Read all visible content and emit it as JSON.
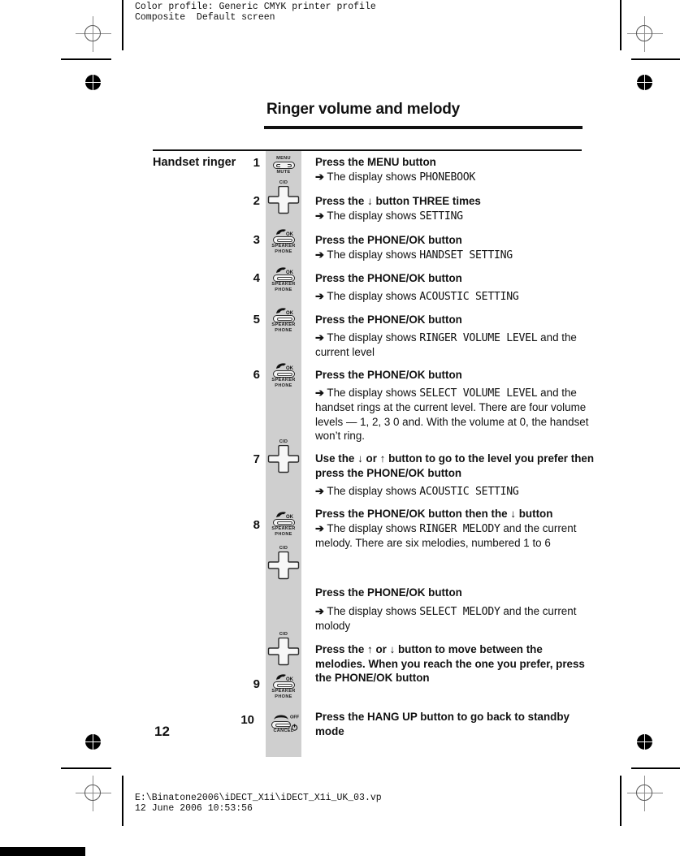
{
  "prepress": {
    "profile_line": "Color profile: Generic CMYK printer profile\nComposite  Default screen",
    "footer_path": "E:\\Binatone2006\\iDECT_X1i\\iDECT_X1i_UK_03.vp\n12 June 2006 10:53:56"
  },
  "page": {
    "title": "Ringer volume and melody",
    "number": "12",
    "section_label": "Handset ringer"
  },
  "steps": [
    {
      "num": "1",
      "icon": "menu-mute-key",
      "lines": [
        {
          "type": "header",
          "parts": [
            {
              "t": "Press the ",
              "style": "bold"
            },
            {
              "t": "MENU",
              "style": "bold"
            },
            {
              "t": " button",
              "style": "bold"
            }
          ]
        },
        {
          "type": "result",
          "arrow": "➔",
          "label": "The display shows",
          "lcd": "PHONEBOOK"
        }
      ]
    },
    {
      "num": "2",
      "icon": "dpad-cid-key",
      "lines": [
        {
          "type": "header",
          "parts": [
            {
              "t": "Press the ",
              "style": "bold"
            },
            {
              "t": "↓",
              "style": "bold"
            },
            {
              "t": " button THREE times",
              "style": "bold"
            }
          ]
        },
        {
          "type": "result",
          "arrow": "➔",
          "label": "The display shows",
          "lcd": "SETTING"
        }
      ]
    },
    {
      "num": "3",
      "icon": "phone-ok-key",
      "lines": [
        {
          "type": "header",
          "parts": [
            {
              "t": "Press the ",
              "style": "bold"
            },
            {
              "t": "PHONE/OK",
              "style": "bold"
            },
            {
              "t": " button",
              "style": "bold"
            }
          ]
        },
        {
          "type": "result",
          "arrow": "➔",
          "label": "The display shows",
          "lcd": "HANDSET SETTING"
        }
      ]
    },
    {
      "num": "4",
      "icon": "phone-ok-key",
      "lines": [
        {
          "type": "header",
          "parts": [
            {
              "t": "Press the ",
              "style": "bold"
            },
            {
              "t": "PHONE/OK",
              "style": "bold"
            },
            {
              "t": " button",
              "style": "bold"
            }
          ]
        },
        {
          "type": "result",
          "arrow": "➔",
          "label": "The display shows",
          "lcd": "ACOUSTIC SETTING"
        }
      ]
    },
    {
      "num": "5",
      "icon": "phone-ok-key",
      "lines": [
        {
          "type": "header",
          "parts": [
            {
              "t": "Press the ",
              "style": "bold"
            },
            {
              "t": "PHONE/OK",
              "style": "bold"
            },
            {
              "t": " button",
              "style": "bold"
            }
          ]
        },
        {
          "type": "result",
          "arrow": "➔",
          "label": "The display shows",
          "lcd": "RINGER VOLUME LEVEL",
          "tail": "and the current level"
        }
      ]
    },
    {
      "num": "6",
      "icon": "phone-ok-key",
      "lines": [
        {
          "type": "header",
          "parts": [
            {
              "t": "Press the ",
              "style": "bold"
            },
            {
              "t": "PHONE/OK",
              "style": "bold"
            },
            {
              "t": " button",
              "style": "bold"
            }
          ]
        },
        {
          "type": "result",
          "arrow": "➔",
          "label": "The display shows",
          "lcd": "SELECT VOLUME LEVEL",
          "tail": "and the handset rings at the current level. There are four volume levels — 1, 2, 3  0 and. With the volume at  0, the handset won’t ring."
        }
      ]
    },
    {
      "num": "7",
      "icon": "dpad-cid-key",
      "lines": [
        {
          "type": "header",
          "parts": [
            {
              "t": "Use the ",
              "style": "bold"
            },
            {
              "t": "↓",
              "style": "bold"
            },
            {
              "t": " or ",
              "style": "bold"
            },
            {
              "t": "↑",
              "style": "bold"
            },
            {
              "t": " button to go to the level you prefer then press the ",
              "style": "bold"
            },
            {
              "t": "PHONE/OK",
              "style": "bold"
            },
            {
              "t": " button",
              "style": "bold"
            }
          ]
        },
        {
          "type": "result",
          "arrow": "➔",
          "label": "The display shows",
          "lcd": "ACOUSTIC SETTING"
        }
      ]
    },
    {
      "num": "8",
      "icon": "phone-ok-key",
      "lines": [
        {
          "type": "header",
          "parts": [
            {
              "t": "Press the ",
              "style": "bold"
            },
            {
              "t": "PHONE/OK",
              "style": "bold"
            },
            {
              "t": " button then the ",
              "style": "bold"
            },
            {
              "t": "↓",
              "style": "bold"
            },
            {
              "t": " button",
              "style": "bold"
            }
          ]
        },
        {
          "type": "result",
          "arrow": "➔",
          "label": "The display shows",
          "lcd": "RINGER MELODY",
          "tail": "and the current melody. There are six melodies, numbered 1 to 6"
        }
      ]
    },
    {
      "num": "",
      "icon": "dpad-cid-key",
      "lines": [
        {
          "type": "header",
          "parts": [
            {
              "t": "Press the ",
              "style": "bold"
            },
            {
              "t": "PHONE/OK",
              "style": "bold"
            },
            {
              "t": " button",
              "style": "bold"
            }
          ]
        },
        {
          "type": "result",
          "arrow": "➔",
          "label": "The display shows",
          "lcd": "SELECT MELODY",
          "tail": " and the current molody"
        }
      ]
    },
    {
      "num": "9",
      "icon": "dpad-cid-key",
      "lines": [
        {
          "type": "header",
          "parts": [
            {
              "t": "Press the ",
              "style": "bold"
            },
            {
              "t": "↑",
              "style": "bold"
            },
            {
              "t": " or ",
              "style": "bold"
            },
            {
              "t": "↓",
              "style": "bold"
            },
            {
              "t": " button to move between the melodies. When you reach the one you prefer, press the ",
              "style": "bold"
            },
            {
              "t": "PHONE/OK",
              "style": "bold"
            },
            {
              "t": " button",
              "style": "bold"
            }
          ]
        }
      ]
    },
    {
      "num": "10",
      "icon": "hangup-cancel-key",
      "lines": [
        {
          "type": "header",
          "parts": [
            {
              "t": "Press the ",
              "style": "bold"
            },
            {
              "t": "HANG UP",
              "style": "bold"
            },
            {
              "t": " button to go back to standby mode",
              "style": "bold"
            }
          ]
        }
      ]
    }
  ],
  "key_icons": {
    "menu": "MENU",
    "mute": "MUTE",
    "cid": "CID",
    "ok": "OK",
    "speaker": "SPEAKER",
    "phone": "PHONE",
    "off": "OFF",
    "cancel": "CANCEL",
    "power": "⏻"
  },
  "step_text": {
    "display_shows": "The display shows",
    "arrow_glyph": "➔"
  }
}
